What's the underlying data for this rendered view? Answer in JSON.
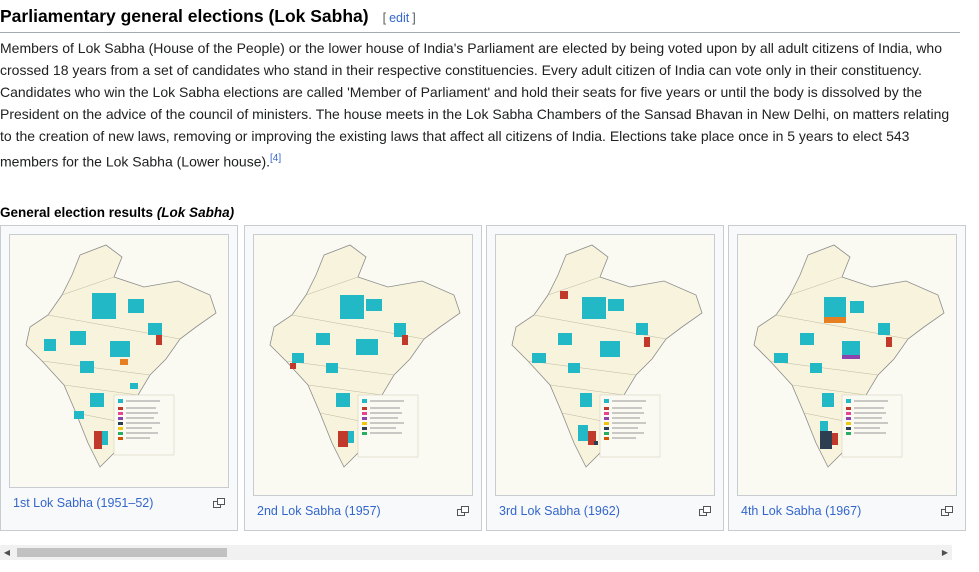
{
  "section": {
    "title": "Parliamentary general elections (Lok Sabha)",
    "edit_open": "[",
    "edit_label": "edit",
    "edit_close": "]"
  },
  "paragraph": {
    "text": "Members of Lok Sabha (House of the People) or the lower house of India's Parliament are elected by being voted upon by all adult citizens of India, who crossed 18 years from a set of candidates who stand in their respective constituencies. Every adult citizen of India can vote only in their constituency. Candidates who win the Lok Sabha elections are called 'Member of Parliament' and hold their seats for five years or until the body is dissolved by the President on the advice of the council of ministers. The house meets in the Lok Sabha Chambers of the Sansad Bhavan in New Delhi, on matters relating to the creation of new laws, removing or improving the existing laws that affect all citizens of India. Elections take place once in 5 years to elect 543 members for the Lok Sabha (Lower house).",
    "ref": "[4]"
  },
  "gallery": {
    "title_prefix": "General election results ",
    "title_italic": "(Lok Sabha)",
    "items": [
      {
        "caption": "1st Lok Sabha (1951–52)"
      },
      {
        "caption": "2nd Lok Sabha (1957)"
      },
      {
        "caption": "3rd Lok Sabha (1962)"
      },
      {
        "caption": "4th Lok Sabha (1967)"
      }
    ]
  },
  "colors": {
    "link": "#3366cc",
    "map_land": "#f7f3dc",
    "map_border": "#8c8c8c",
    "congress": "#22b8c6",
    "cpi": "#c0392b"
  },
  "icons": {
    "enlarge": "enlarge-icon",
    "scroll_left": "scroll-left-arrow-icon",
    "scroll_right": "scroll-right-arrow-icon"
  }
}
